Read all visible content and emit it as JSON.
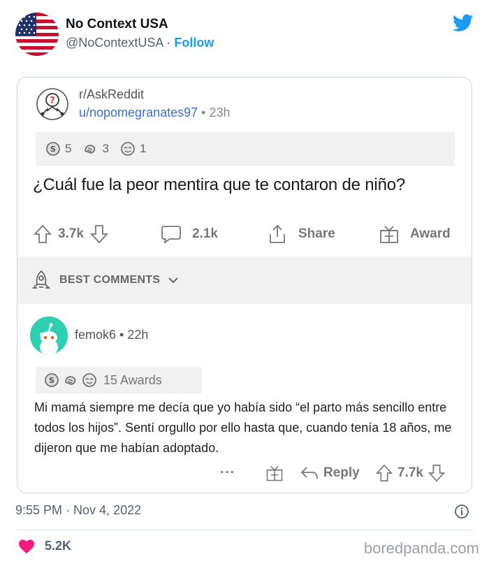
{
  "tweet": {
    "display_name": "No Context USA",
    "handle": "@NoContextUSA",
    "separator": "·",
    "follow_label": "Follow",
    "timestamp": "9:55 PM · Nov 4, 2022",
    "likes": "5.2K"
  },
  "post": {
    "subreddit": "r/AskReddit",
    "user": "u/nopomegranates97",
    "separator": "•",
    "age": "23h",
    "awards": [
      "5",
      "3",
      "1"
    ],
    "title": "¿Cuál fue la peor mentira que te contaron de niño?",
    "upvotes": "3.7k",
    "comments": "2.1k",
    "share_label": "Share",
    "award_label": "Award",
    "best_comments_label": "BEST COMMENTS"
  },
  "comment": {
    "user": "femok6",
    "separator": "•",
    "age": "22h",
    "awards_label": "15 Awards",
    "body": "Mi mamá siempre me decía que yo había sido “el parto más sencillo entre todos los hijos”. Sentí orgullo por ello hasta que, cuando tenía 18 años, me dijeron que me habían adoptado.",
    "more_label": "···",
    "reply_label": "Reply",
    "votes": "7.7k"
  },
  "watermark": "boredpanda.com",
  "colors": {
    "twitter_blue": "#1d9bf0",
    "like_red": "#f91880",
    "reddit_link": "#3a6fd8",
    "comment_avatar": "#2fcfb2"
  },
  "icons": [
    "us-flag-avatar",
    "twitter-bird-icon",
    "askreddit-icon",
    "silver-award-icon",
    "helpful-award-icon",
    "wholesome-award-icon",
    "upvote-icon",
    "downvote-icon",
    "comment-icon",
    "share-icon",
    "gift-icon",
    "rocket-icon",
    "chevron-down-icon",
    "snoo-avatar",
    "reply-icon",
    "info-icon",
    "heart-icon"
  ]
}
